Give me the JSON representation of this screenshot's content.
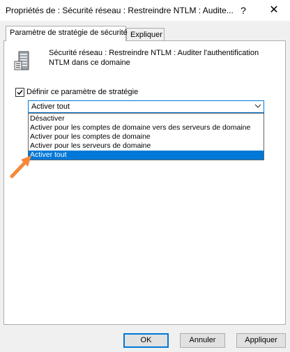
{
  "window": {
    "title": "Propriétés de : Sécurité réseau : Restreindre NTLM : Audite...",
    "help_label": "?",
    "close_label": "✕"
  },
  "tabs": [
    {
      "label": "Paramètre de stratégie de sécurité",
      "active": true
    },
    {
      "label": "Expliquer",
      "active": false
    }
  ],
  "policy": {
    "icon": "server-policy-icon",
    "description": "Sécurité réseau : Restreindre NTLM : Auditer l'authentification NTLM dans ce domaine"
  },
  "define_setting": {
    "label": "Définir ce paramètre de stratégie",
    "checked": true
  },
  "select": {
    "value": "Activer tout",
    "options": [
      "Désactiver",
      "Activer pour les comptes de domaine vers des serveurs de domaine",
      "Activer pour les comptes de domaine",
      "Activer pour les serveurs de domaine",
      "Activer tout"
    ],
    "highlighted_index": 4
  },
  "annotation": {
    "icon": "orange-arrow-icon",
    "color": "#f7883a"
  },
  "buttons": {
    "ok": "OK",
    "cancel": "Annuler",
    "apply": "Appliquer"
  },
  "colors": {
    "accent": "#0078d7",
    "panel_bg": "#ffffff",
    "window_bg": "#f0f0f0"
  }
}
